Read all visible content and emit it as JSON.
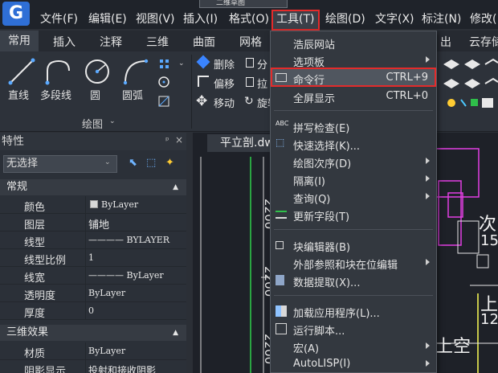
{
  "menubar": {
    "items": [
      "文件(F)",
      "编辑(E)",
      "视图(V)",
      "插入(I)",
      "格式(O)",
      "工具(T)",
      "绘图(D)",
      "文字(X)",
      "标注(N)",
      "修改("
    ],
    "tab_stub": "二维草图"
  },
  "ribbon_tabs": [
    "常用",
    "插入",
    "注释",
    "三维",
    "曲面",
    "网格",
    "出",
    "云存储"
  ],
  "ribbon": {
    "draw_tools": [
      "直线",
      "多段线",
      "圆",
      "圆弧"
    ],
    "modify_tools": [
      "删除",
      "偏移",
      "移动",
      "分",
      "拉",
      "旋转"
    ],
    "panel_title": "绘图"
  },
  "properties": {
    "title": "特性",
    "selection": "无选择",
    "section_general": "常规",
    "rows": [
      {
        "key": "颜色",
        "value": "ByLayer"
      },
      {
        "key": "图层",
        "value": "铺地"
      },
      {
        "key": "线型",
        "value": "———— BYLAYER"
      },
      {
        "key": "线型比例",
        "value": "1"
      },
      {
        "key": "线宽",
        "value": "———— ByLayer"
      },
      {
        "key": "透明度",
        "value": "ByLayer"
      },
      {
        "key": "厚度",
        "value": "0"
      }
    ],
    "section_3d": "三维效果",
    "rows_3d": [
      {
        "key": "材质",
        "value": "ByLayer"
      },
      {
        "key": "阴影显示",
        "value": "投射和接收阴影"
      }
    ]
  },
  "drawing": {
    "doc_tab": "平立剖.dwg",
    "dims": [
      "2200",
      "2200",
      "2200"
    ],
    "texts": [
      "次",
      "15",
      "上",
      "12.",
      "上空"
    ]
  },
  "tools_menu": {
    "items": [
      {
        "label": "浩辰网站",
        "shortcut": "",
        "submenu": false
      },
      {
        "label": "选项板",
        "shortcut": "",
        "submenu": true
      },
      {
        "label": "命令行",
        "shortcut": "CTRL+9",
        "submenu": false
      },
      {
        "label": "全屏显示",
        "shortcut": "CTRL+0",
        "submenu": false
      },
      {
        "label": "拼写检查(E)",
        "shortcut": "",
        "submenu": false
      },
      {
        "label": "快速选择(K)...",
        "shortcut": "",
        "submenu": false
      },
      {
        "label": "绘图次序(D)",
        "shortcut": "",
        "submenu": true
      },
      {
        "label": "隔离(I)",
        "shortcut": "",
        "submenu": true
      },
      {
        "label": "查询(Q)",
        "shortcut": "",
        "submenu": true
      },
      {
        "label": "更新字段(T)",
        "shortcut": "",
        "submenu": false
      },
      {
        "label": "块编辑器(B)",
        "shortcut": "",
        "submenu": false
      },
      {
        "label": "外部参照和块在位编辑",
        "shortcut": "",
        "submenu": true
      },
      {
        "label": "数据提取(X)...",
        "shortcut": "",
        "submenu": false
      },
      {
        "label": "加载应用程序(L)...",
        "shortcut": "",
        "submenu": false
      },
      {
        "label": "运行脚本...",
        "shortcut": "",
        "submenu": false
      },
      {
        "label": "宏(A)",
        "shortcut": "",
        "submenu": true
      },
      {
        "label": "AutoLISP(I)",
        "shortcut": "",
        "submenu": true
      }
    ]
  },
  "colors": {
    "accent": "#e32b2b",
    "highlight": "#50565f",
    "logo": "#2f6fd6"
  }
}
